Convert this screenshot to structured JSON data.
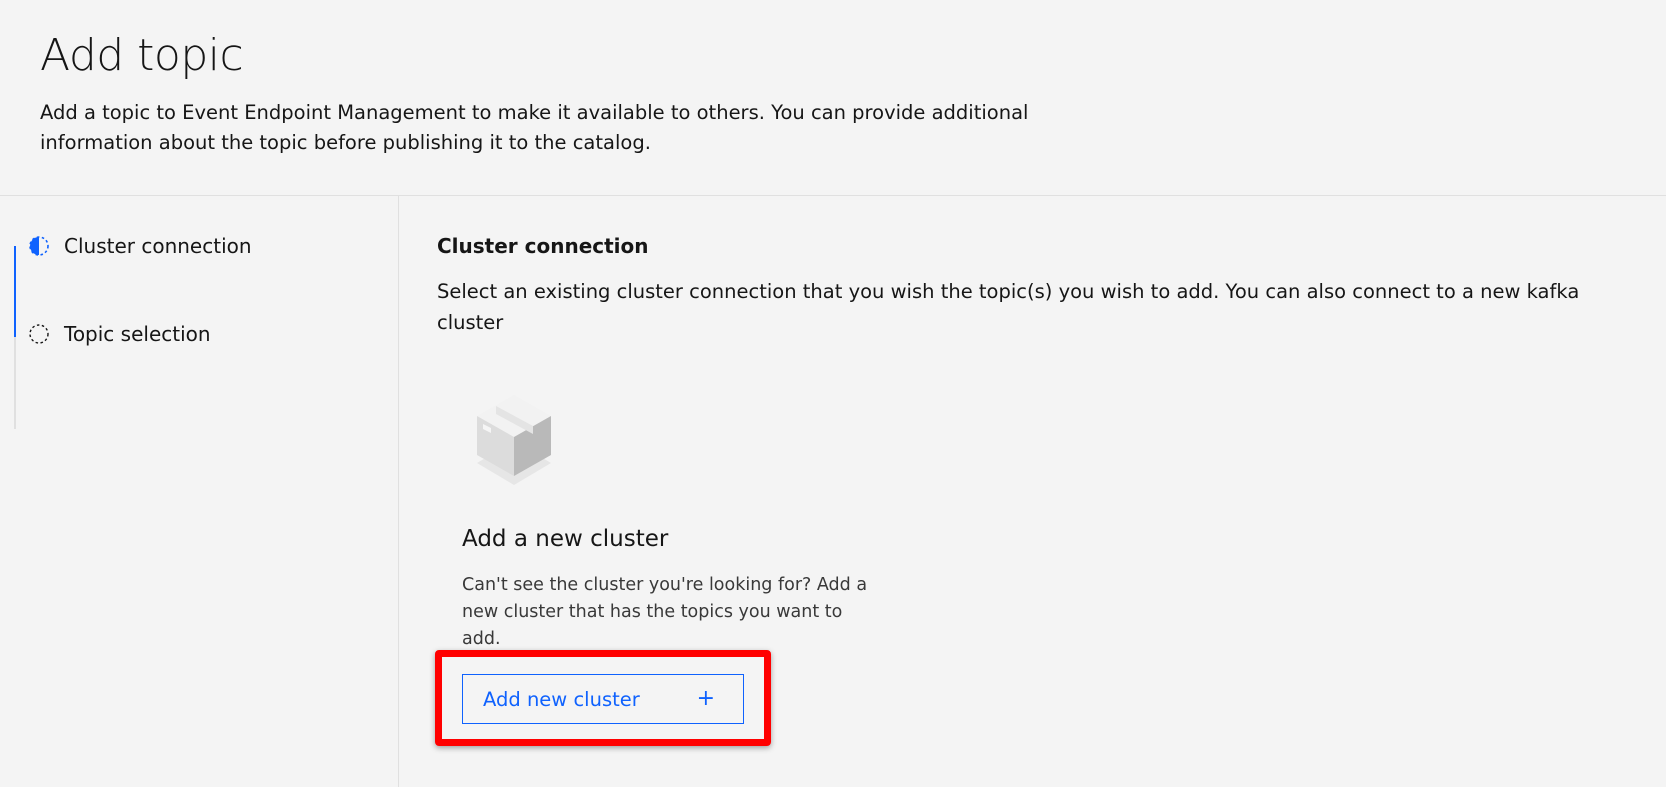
{
  "header": {
    "title": "Add topic",
    "description": "Add a topic to Event Endpoint Management to make it available to others. You can provide additional information about the topic before publishing it to the catalog."
  },
  "steps": [
    {
      "label": "Cluster connection",
      "state": "current",
      "icon": "half-filled-circle-icon"
    },
    {
      "label": "Topic selection",
      "state": "not-started",
      "icon": "dashed-circle-icon"
    }
  ],
  "main": {
    "section_title": "Cluster connection",
    "section_description": "Select an existing cluster connection that you wish the topic(s) you wish to add. You can also connect to a new kafka cluster",
    "card": {
      "icon": "cube-box-icon",
      "title": "Add a new cluster",
      "description": "Can't see the cluster you're looking for? Add a new cluster that has the topics you want to add.",
      "button_label": "Add new cluster",
      "button_icon": "plus-icon",
      "button_icon_glyph": "+"
    }
  },
  "colors": {
    "accent": "#0f62fe",
    "background": "#f4f4f4",
    "highlight": "#ff0000"
  }
}
